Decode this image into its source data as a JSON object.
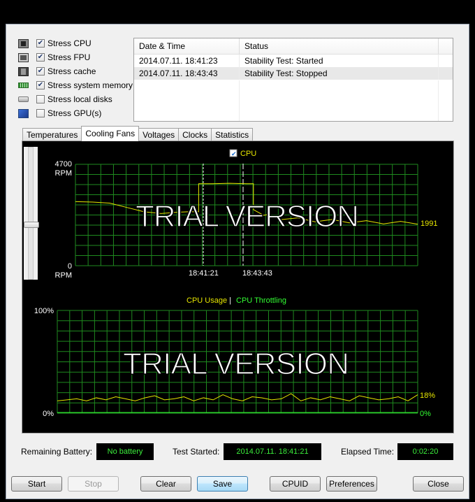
{
  "stress_options": [
    {
      "label": "Stress CPU",
      "checked": true,
      "icon": "cpu-icon"
    },
    {
      "label": "Stress FPU",
      "checked": true,
      "icon": "fpu-icon"
    },
    {
      "label": "Stress cache",
      "checked": true,
      "icon": "cache-icon"
    },
    {
      "label": "Stress system memory",
      "checked": true,
      "icon": "memory-icon"
    },
    {
      "label": "Stress local disks",
      "checked": false,
      "icon": "disk-icon"
    },
    {
      "label": "Stress GPU(s)",
      "checked": false,
      "icon": "gpu-icon"
    }
  ],
  "log": {
    "headers": [
      "Date & Time",
      "Status"
    ],
    "rows": [
      {
        "datetime": "2014.07.11. 18:41:23",
        "status": "Stability Test: Started"
      },
      {
        "datetime": "2014.07.11. 18:43:43",
        "status": "Stability Test: Stopped"
      }
    ]
  },
  "tabs": [
    {
      "label": "Temperatures",
      "active": false
    },
    {
      "label": "Cooling Fans",
      "active": true
    },
    {
      "label": "Voltages",
      "active": false
    },
    {
      "label": "Clocks",
      "active": false
    },
    {
      "label": "Statistics",
      "active": false
    }
  ],
  "fan_chart": {
    "legend_label": "CPU",
    "legend_checked": true,
    "y_max_label": "4700",
    "y_max_unit": "RPM",
    "y_min_label": "0",
    "y_min_unit": "RPM",
    "x_label_start": "18:41:21",
    "x_label_stop": "18:43:43",
    "current_value": "1991",
    "watermark": "TRIAL VERSION"
  },
  "usage_chart": {
    "legend_usage": "CPU Usage",
    "legend_sep": "|",
    "legend_throttling": "CPU Throttling",
    "y_max_label": "100%",
    "y_min_label": "0%",
    "current_usage": "18%",
    "current_throttling": "0%",
    "watermark": "TRIAL VERSION"
  },
  "chart_data": [
    {
      "type": "line",
      "series": [
        {
          "name": "CPU",
          "x": [
            0,
            5,
            10,
            15,
            20,
            25,
            30,
            33,
            36,
            40,
            45,
            50,
            52,
            55,
            56,
            60,
            65,
            70,
            75,
            80,
            85,
            90,
            95,
            100
          ],
          "values": [
            2970,
            2950,
            2900,
            2700,
            2500,
            2420,
            2480,
            2500,
            3800,
            3800,
            3820,
            3800,
            2600,
            2400,
            2300,
            2200,
            2150,
            2100,
            2080,
            2050,
            2020,
            2000,
            1991,
            1991
          ]
        }
      ],
      "ylim": [
        0,
        4700
      ],
      "annotations": [
        "18:41:21",
        "18:43:43"
      ]
    },
    {
      "type": "line",
      "series": [
        {
          "name": "CPU Usage",
          "values": [
            12,
            13,
            14,
            12,
            15,
            13,
            16,
            14,
            12,
            15,
            17,
            13,
            14,
            16,
            12,
            15,
            13,
            18,
            14,
            12,
            16,
            15,
            13,
            14,
            19,
            12,
            15,
            13,
            16,
            14,
            12,
            17,
            15,
            13,
            14,
            16,
            12,
            18
          ]
        },
        {
          "name": "CPU Throttling",
          "values": [
            0,
            0,
            0,
            0,
            0,
            0,
            0,
            0,
            0,
            0,
            0,
            0,
            0,
            0,
            0,
            0,
            0,
            0,
            0,
            0,
            0,
            0,
            0,
            0,
            0,
            0,
            0,
            0,
            0,
            0,
            0,
            0,
            0,
            0,
            0,
            0,
            0,
            0
          ]
        }
      ],
      "ylim": [
        0,
        100
      ]
    }
  ],
  "battery": {
    "label": "Remaining Battery:",
    "value": "No battery"
  },
  "test_started": {
    "label": "Test Started:",
    "value": "2014.07.11. 18:41:21"
  },
  "elapsed": {
    "label": "Elapsed Time:",
    "value": "0:02:20"
  },
  "buttons": {
    "start": "Start",
    "stop": "Stop",
    "clear": "Clear",
    "save": "Save",
    "cpuid": "CPUID",
    "preferences": "Preferences",
    "close": "Close"
  },
  "colors": {
    "grid": "#1f8a1f",
    "line": "#e6e600",
    "throttle": "#33ff33",
    "accent": "#3cf03c"
  }
}
